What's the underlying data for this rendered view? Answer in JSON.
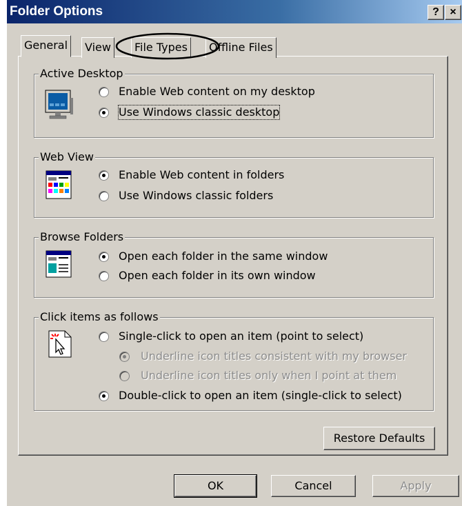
{
  "window": {
    "title": "Folder Options",
    "help_button": "?",
    "close_button": "×"
  },
  "tabs": [
    {
      "label": "General",
      "selected": true
    },
    {
      "label": "View",
      "selected": false
    },
    {
      "label": "File Types",
      "selected": false
    },
    {
      "label": "Offline Files",
      "selected": false
    }
  ],
  "groups": {
    "active_desktop": {
      "title": "Active Desktop",
      "icon": "desktop-icon",
      "options": [
        {
          "label": "Enable Web content on my desktop",
          "checked": false
        },
        {
          "label": "Use Windows classic desktop",
          "checked": true
        }
      ]
    },
    "web_view": {
      "title": "Web View",
      "icon": "web-view-folder-icon",
      "options": [
        {
          "label": "Enable Web content in folders",
          "checked": true
        },
        {
          "label": "Use Windows classic folders",
          "checked": false
        }
      ]
    },
    "browse_folders": {
      "title": "Browse Folders",
      "icon": "browse-folder-window-icon",
      "options": [
        {
          "label": "Open each folder in the same window",
          "checked": true
        },
        {
          "label": "Open each folder in its own window",
          "checked": false
        }
      ]
    },
    "click_items": {
      "title": "Click items as follows",
      "icon": "pointer-click-icon",
      "options": [
        {
          "label": "Single-click to open an item (point to select)",
          "checked": false
        },
        {
          "label": "Underline icon titles consistent with my browser",
          "checked": true,
          "disabled": true
        },
        {
          "label": "Underline icon titles only when I point at them",
          "checked": false,
          "disabled": true
        },
        {
          "label": "Double-click to open an item (single-click to select)",
          "checked": true
        }
      ]
    }
  },
  "restore_defaults_label": "Restore Defaults",
  "footer": {
    "ok_label": "OK",
    "cancel_label": "Cancel",
    "apply_label": "Apply"
  },
  "annotation": "ellipse around File Types tab"
}
